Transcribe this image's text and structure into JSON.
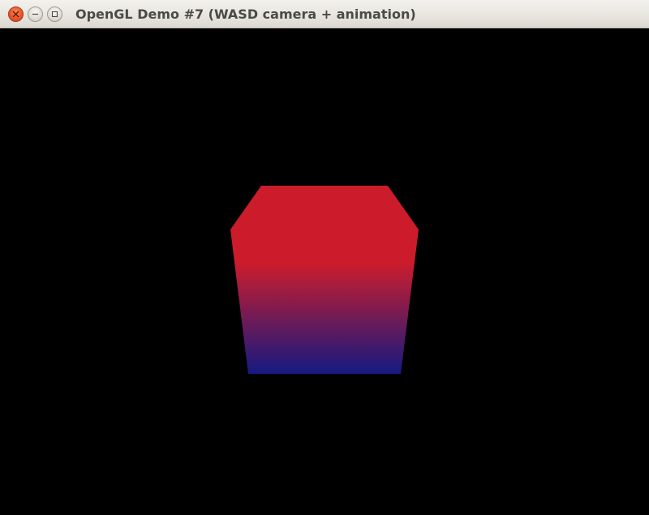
{
  "window": {
    "title": "OpenGL Demo #7 (WASD camera + animation)",
    "controls": {
      "close_icon": "close-icon",
      "minimize_icon": "minimize-icon",
      "maximize_icon": "maximize-icon"
    }
  },
  "scene": {
    "background_color": "#000000",
    "cube": {
      "top_color": "#cc1c2b",
      "bottom_color": "#151a80"
    }
  }
}
